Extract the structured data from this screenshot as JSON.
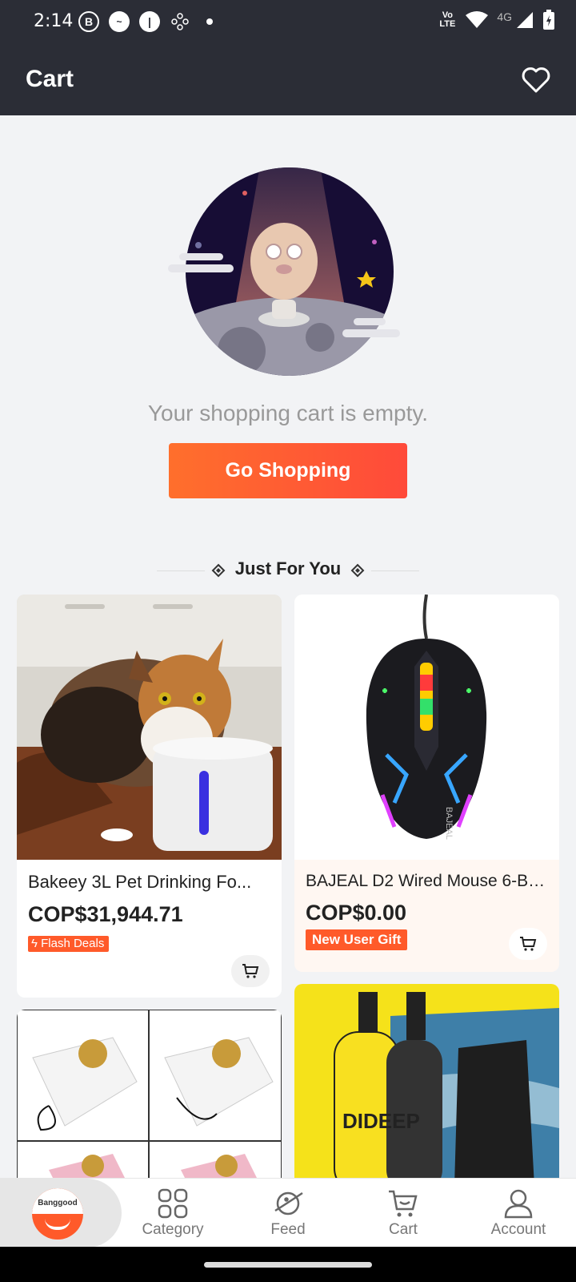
{
  "status_bar": {
    "time": "2:14",
    "left_icons": [
      "b-icon",
      "messenger-icon",
      "app-icon",
      "settings-dots-icon",
      "dot-icon"
    ],
    "network": "4G",
    "volte": "Vo LTE"
  },
  "header": {
    "title": "Cart",
    "wishlist_icon": "heart-icon"
  },
  "empty_state": {
    "message": "Your shopping cart is empty.",
    "button_label": "Go Shopping"
  },
  "recommendations": {
    "title": "Just For You",
    "products": [
      {
        "title": "Bakeey 3L Pet Drinking Fo...",
        "price": "COP$31,944.71",
        "badge": "Flash Deals",
        "image": "cat with pet water fountain"
      },
      {
        "title": "BAJEAL D2 Wired Mouse 6-Bu...",
        "price": "COP$0.00",
        "badge": "New User Gift",
        "image": "rgb gaming mouse",
        "image_text": "BAJEAL"
      },
      {
        "title": "",
        "price": "",
        "image": "nail dust collector fans"
      },
      {
        "title": "",
        "price": "",
        "image": "diving oxygen tanks",
        "image_text": "DIDEEP"
      }
    ]
  },
  "bottom_nav": {
    "home_logo_text": "Banggood",
    "items": [
      {
        "label": "Category",
        "icon": "grid-icon"
      },
      {
        "label": "Feed",
        "icon": "planet-icon"
      },
      {
        "label": "Cart",
        "icon": "cart-icon"
      },
      {
        "label": "Account",
        "icon": "person-icon"
      }
    ]
  },
  "colors": {
    "header_bg": "#2b2d36",
    "accent": "#ff5a2a",
    "page_bg": "#f2f3f5"
  }
}
